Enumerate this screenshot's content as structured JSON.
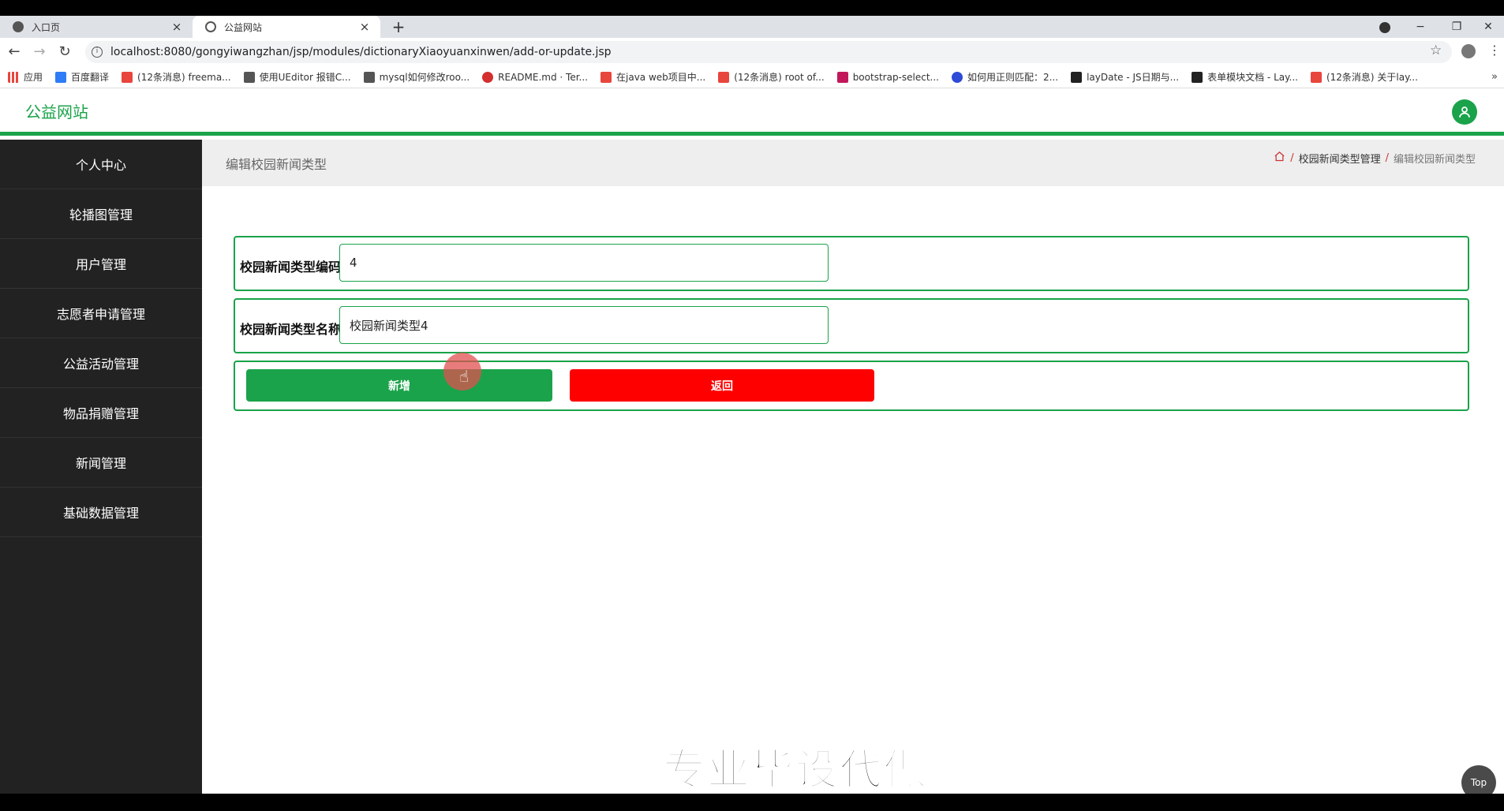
{
  "browser": {
    "tabs": [
      {
        "label": "入口页",
        "close": "×"
      },
      {
        "label": "公益网站",
        "close": "×"
      }
    ],
    "new_tab": "+",
    "window_controls": {
      "minimize": "−",
      "restore": "❐",
      "close": "✕"
    },
    "url": "localhost:8080/gongyiwangzhan/jsp/modules/dictionaryXiaoyuanxinwen/add-or-update.jsp",
    "bookmarks": [
      {
        "label": "应用",
        "color": "#e8453c"
      },
      {
        "label": "百度翻译",
        "color": "#2e7cf6"
      },
      {
        "label": "(12条消息) freema...",
        "color": "#e8453c"
      },
      {
        "label": "使用UEditor 报错C...",
        "color": "#555555"
      },
      {
        "label": "mysql如何修改roo...",
        "color": "#555555"
      },
      {
        "label": "README.md · Ter...",
        "color": "#d32f2f"
      },
      {
        "label": "在java web项目中...",
        "color": "#e8453c"
      },
      {
        "label": "(12条消息) root of...",
        "color": "#e8453c"
      },
      {
        "label": "bootstrap-select...",
        "color": "#c2185b"
      },
      {
        "label": "如何用正则匹配：2...",
        "color": "#2e4ad6"
      },
      {
        "label": "layDate - JS日期与...",
        "color": "#222222"
      },
      {
        "label": "表单模块文档 - Lay...",
        "color": "#222222"
      },
      {
        "label": "(12条消息) 关于lay...",
        "color": "#e8453c"
      }
    ],
    "bookmarks_more": "»"
  },
  "app": {
    "title": "公益网站",
    "accent": "#1aa34a"
  },
  "sidebar": {
    "items": [
      {
        "label": "个人中心"
      },
      {
        "label": "轮播图管理"
      },
      {
        "label": "用户管理"
      },
      {
        "label": "志愿者申请管理"
      },
      {
        "label": "公益活动管理"
      },
      {
        "label": "物品捐赠管理"
      },
      {
        "label": "新闻管理"
      },
      {
        "label": "基础数据管理"
      }
    ]
  },
  "page": {
    "title": "编辑校园新闻类型",
    "breadcrumb": {
      "sep": "/",
      "parent": "校园新闻类型管理",
      "current": "编辑校园新闻类型"
    }
  },
  "form": {
    "code_label": "校园新闻类型编码",
    "code_value": "4",
    "name_label": "校园新闻类型名称",
    "name_value": "校园新闻类型4",
    "submit_label": "新增",
    "back_label": "返回"
  },
  "overlay": {
    "watermark": "专业毕设代做",
    "top_button": "Top"
  }
}
